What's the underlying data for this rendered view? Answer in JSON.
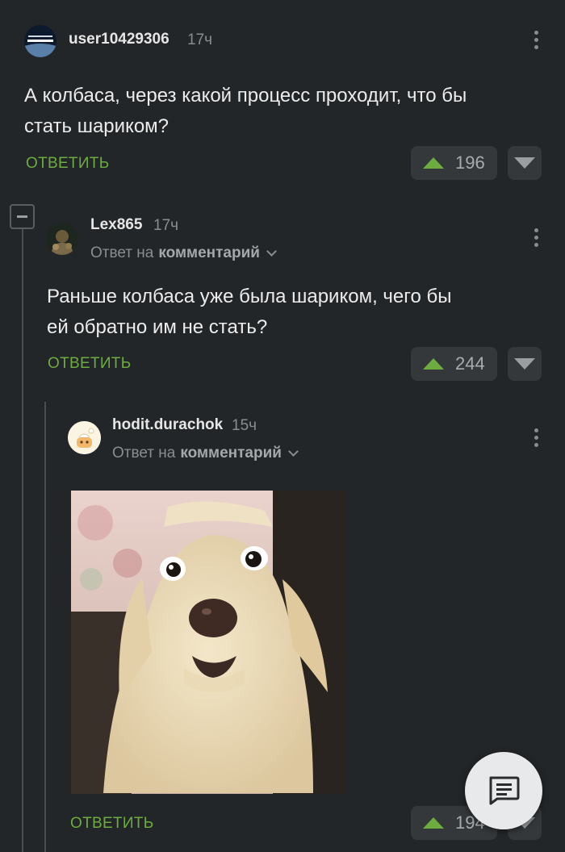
{
  "comments": [
    {
      "username": "user10429306",
      "time": "17ч",
      "avatar_text_top": "The basics of",
      "avatar_text_bottom": "PROGRAMMING",
      "text_line1": "А колбаса, через какой процесс проходит, что бы",
      "text_line2": "стать шариком?",
      "reply_label": "ОТВЕТИТЬ",
      "votes": "196"
    },
    {
      "username": "Lex865",
      "time": "17ч",
      "reply_to_prefix": "Ответ на",
      "reply_to_link": "комментарий",
      "text_line1": "Раньше колбаса уже была шариком, чего бы",
      "text_line2": "ей обратно им не стать?",
      "reply_label": "ОТВЕТИТЬ",
      "votes": "244"
    },
    {
      "username": "hodit.durachok",
      "time": "15ч",
      "reply_to_prefix": "Ответ на",
      "reply_to_link": "комментарий",
      "reply_label": "ОТВЕТИТЬ",
      "votes": "194"
    }
  ],
  "colors": {
    "background": "#232628",
    "accent_green": "#6dac3f",
    "vote_bg": "#34383b"
  },
  "icons": {
    "collapse": "minus-icon",
    "more": "kebab-icon",
    "fab": "comment-icon"
  }
}
